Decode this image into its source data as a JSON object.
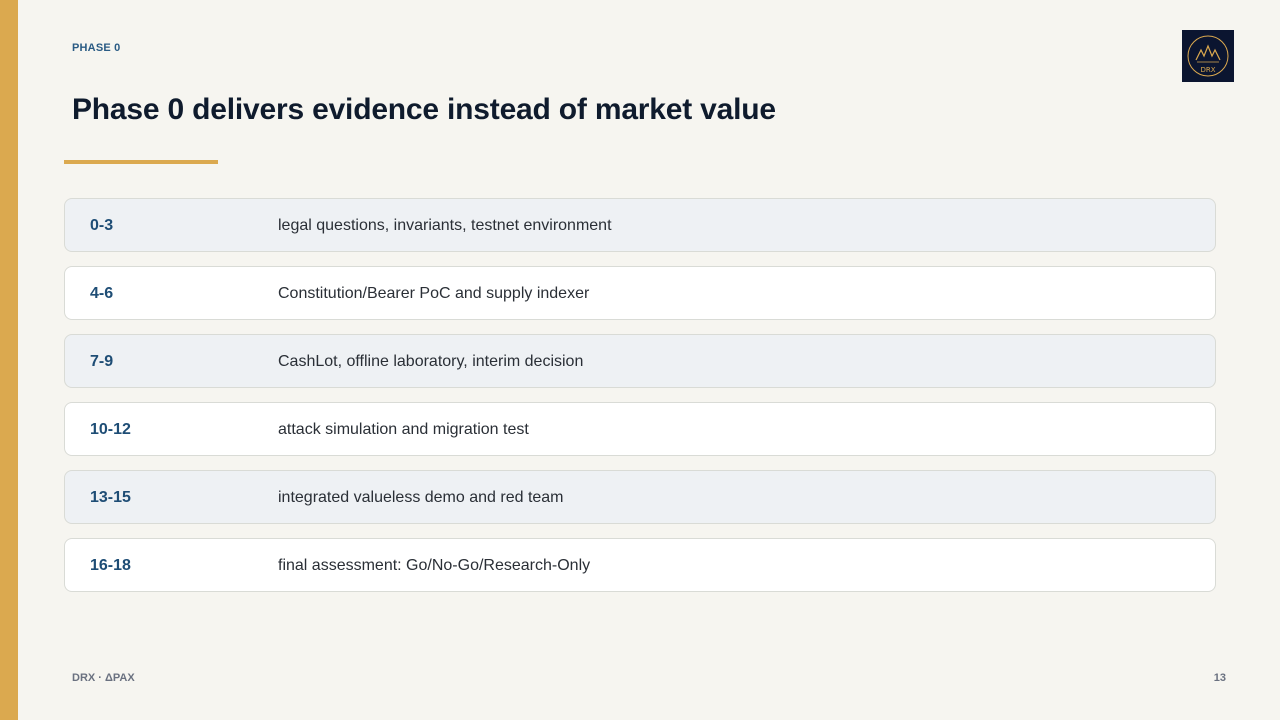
{
  "header": {
    "kicker": "PHASE 0",
    "title": "Phase 0 delivers evidence instead of market value"
  },
  "logo": {
    "text": "DRX",
    "icon": "drx-logo-icon"
  },
  "rows": [
    {
      "range": "0-3",
      "description": "legal questions, invariants, testnet environment"
    },
    {
      "range": "4-6",
      "description": "Constitution/Bearer PoC and supply indexer"
    },
    {
      "range": "7-9",
      "description": "CashLot, offline laboratory, interim decision"
    },
    {
      "range": "10-12",
      "description": "attack simulation and migration test"
    },
    {
      "range": "13-15",
      "description": "integrated valueless demo and red team"
    },
    {
      "range": "16-18",
      "description": "final assessment: Go/No-Go/Research-Only"
    }
  ],
  "footer": {
    "left": "DRX · ΔPAX",
    "page_number": "13"
  },
  "colors": {
    "accent": "#dba94f",
    "primary_text": "#0f1b2d",
    "range_text": "#1e4d75",
    "logo_bg": "#0b1530"
  }
}
